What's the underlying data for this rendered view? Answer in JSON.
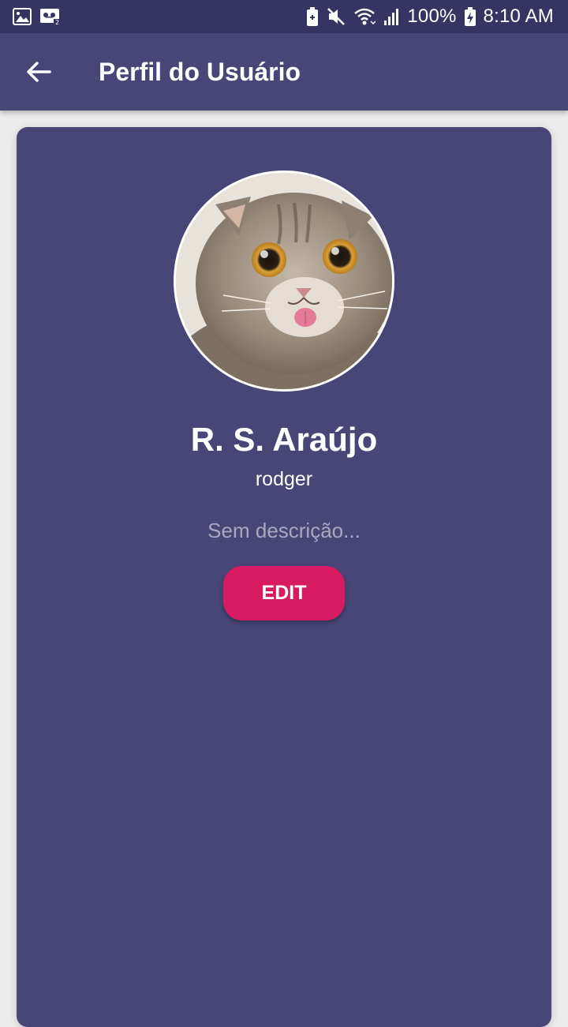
{
  "status_bar": {
    "battery": "100%",
    "time": "8:10 AM",
    "icons_left": [
      "image-icon",
      "voicemail-icon"
    ],
    "icons_right": [
      "battery-saver-icon",
      "mute-icon",
      "wifi-icon",
      "signal-icon",
      "battery-charging-icon"
    ]
  },
  "app_bar": {
    "back_icon": "arrow-back-icon",
    "title": "Perfil do Usuário",
    "color": "#474677"
  },
  "profile": {
    "avatar_alt": "cat photo",
    "name": "R. S. Araújo",
    "username": "rodger",
    "description_placeholder": "Sem descrição..."
  },
  "actions": {
    "edit_label": "EDIT",
    "accent_color": "#d81b60"
  }
}
